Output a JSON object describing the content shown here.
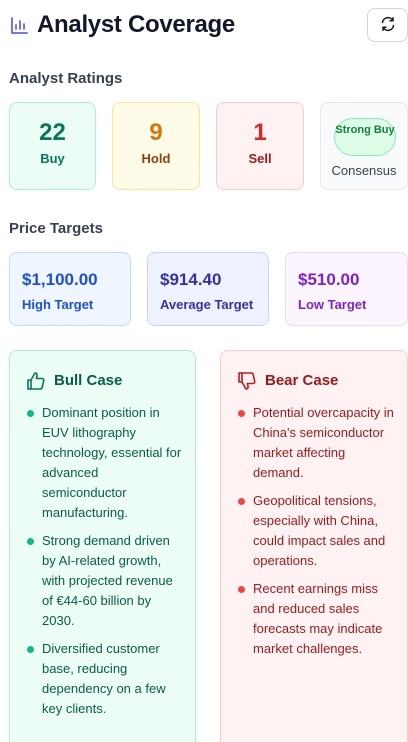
{
  "header": {
    "title": "Analyst Coverage",
    "icon": "bar-chart-icon",
    "refresh_icon": "refresh-icon"
  },
  "ratings": {
    "section_title": "Analyst Ratings",
    "buy": {
      "count": "22",
      "label": "Buy"
    },
    "hold": {
      "count": "9",
      "label": "Hold"
    },
    "sell": {
      "count": "1",
      "label": "Sell"
    },
    "consensus": {
      "badge": "Strong Buy",
      "label": "Consensus"
    }
  },
  "targets": {
    "section_title": "Price Targets",
    "high": {
      "value": "$1,100.00",
      "label": "High Target"
    },
    "average": {
      "value": "$914.40",
      "label": "Average Target"
    },
    "low": {
      "value": "$510.00",
      "label": "Low Target"
    }
  },
  "bull_case": {
    "title": "Bull Case",
    "icon": "thumbs-up-icon",
    "points": [
      "Dominant position in EUV lithography technology, essential for advanced semiconductor manufacturing.",
      "Strong demand driven by AI-related growth, with projected revenue of €44-60 billion by 2030.",
      "Diversified customer base, reducing dependency on a few key clients."
    ]
  },
  "bear_case": {
    "title": "Bear Case",
    "icon": "thumbs-down-icon",
    "points": [
      "Potential overcapacity in China's semiconductor market affecting demand.",
      "Geopolitical tensions, especially with China, could impact sales and operations.",
      "Recent earnings miss and reduced sales forecasts may indicate market challenges."
    ]
  },
  "colors": {
    "buy": "#047857",
    "hold": "#d97706",
    "sell": "#dc2626",
    "accent": "#4f46e5"
  }
}
